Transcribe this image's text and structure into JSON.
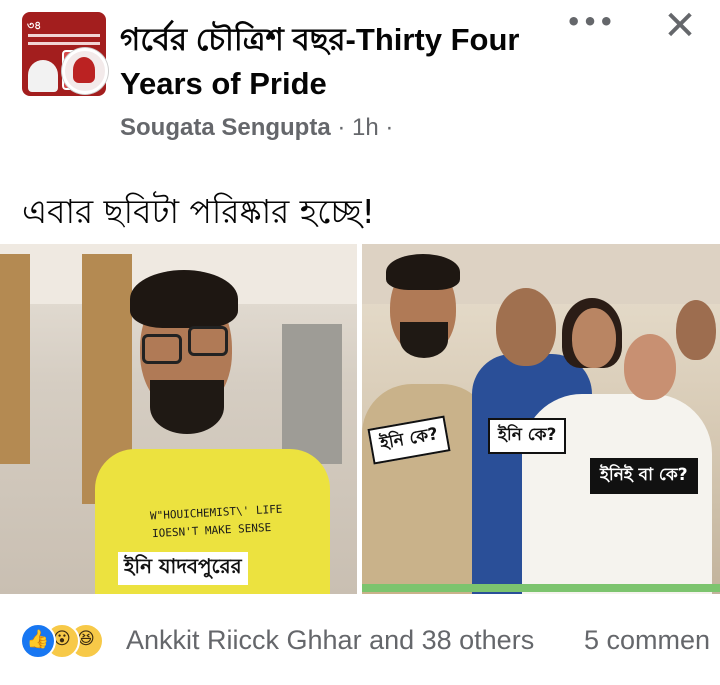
{
  "header": {
    "group_name": "গর্বের চৌত্রিশ বছর-Thirty Four Years of Pride",
    "author": "Sougata Sengupta",
    "separator": " · ",
    "time": "1h",
    "audience_sep": " ·",
    "avatar_number": "৩৪",
    "more_icon": "more-horizontal-icon",
    "more_glyph": "•••",
    "close_icon": "close-icon",
    "close_glyph": "✕"
  },
  "post": {
    "caption": "এবার ছবিটা পরিষ্কার হচ্ছে!",
    "image": {
      "left_shirt_line1": "W\"HOUICHEMIST\\' LIFE",
      "left_shirt_line2": "IOESN'T MAKE SENSE",
      "left_caption": "ইনি যাদবপুরের",
      "right_label_1": "ইনি কে?",
      "right_label_2": "ইনি কে?",
      "right_label_3": "ইনিই বা কে?"
    }
  },
  "reactions": {
    "icons": [
      "like-icon",
      "wow-icon",
      "haha-icon"
    ],
    "like_glyph": "👍",
    "wow_glyph": "😮",
    "haha_glyph": "😆",
    "summary": "Ankkit Riicck Ghhar and 38 others",
    "comments": "5 commen"
  },
  "colors": {
    "secondary_text": "#65676b",
    "like_blue": "#1877f2",
    "emoji_yellow": "#f7c948"
  }
}
